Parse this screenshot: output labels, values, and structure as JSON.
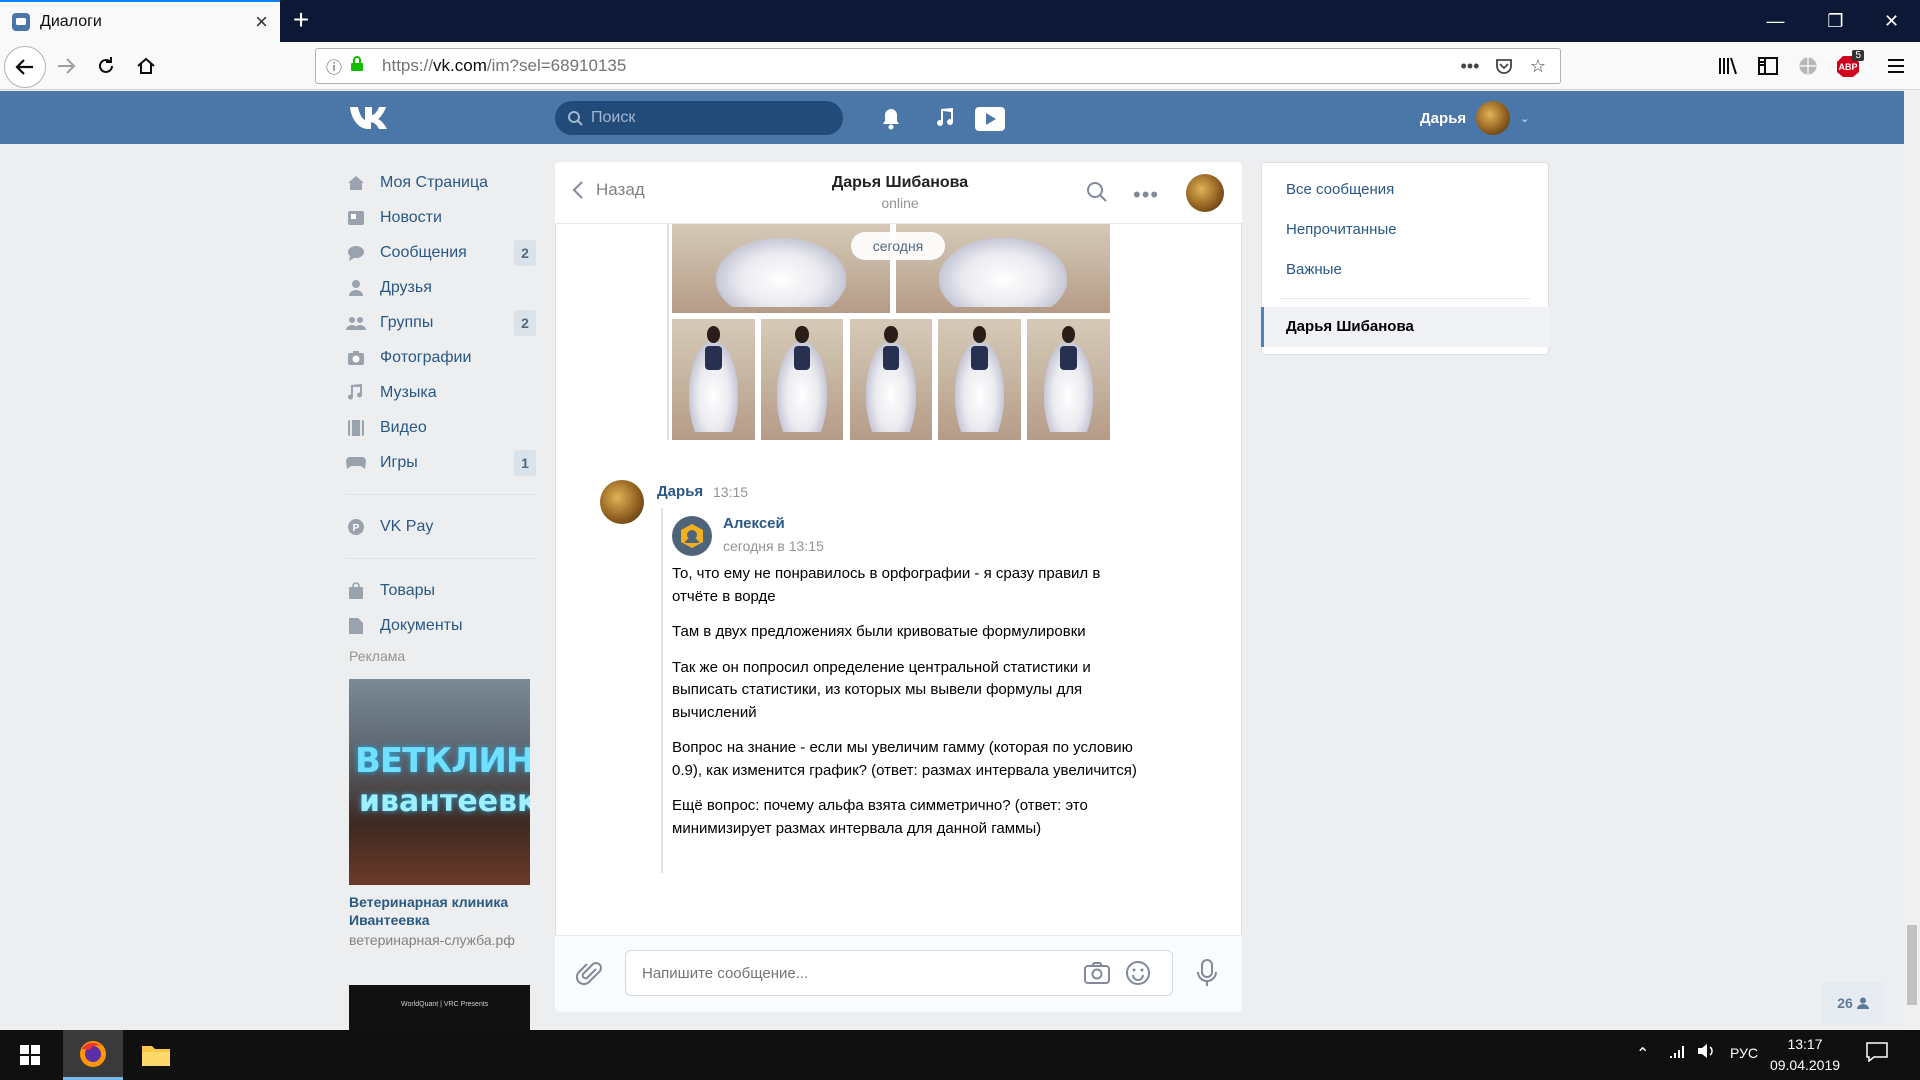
{
  "browser": {
    "tab_title": "Диалоги",
    "url_prefix": "https://",
    "url_host": "vk.com",
    "url_path": "/im?sel=68910135",
    "adblock_count": "5"
  },
  "vk_header": {
    "search_placeholder": "Поиск",
    "user_name": "Дарья"
  },
  "menu": {
    "items": [
      {
        "label": "Моя Страница",
        "icon": "home-icon",
        "badge": ""
      },
      {
        "label": "Новости",
        "icon": "news-icon",
        "badge": ""
      },
      {
        "label": "Сообщения",
        "icon": "messages-icon",
        "badge": "2"
      },
      {
        "label": "Друзья",
        "icon": "friends-icon",
        "badge": ""
      },
      {
        "label": "Группы",
        "icon": "groups-icon",
        "badge": "2"
      },
      {
        "label": "Фотографии",
        "icon": "camera-icon",
        "badge": ""
      },
      {
        "label": "Музыка",
        "icon": "music-icon",
        "badge": ""
      },
      {
        "label": "Видео",
        "icon": "video-icon",
        "badge": ""
      },
      {
        "label": "Игры",
        "icon": "gamepad-icon",
        "badge": "1"
      }
    ],
    "vkpay": "VK Pay",
    "goods": "Товары",
    "docs": "Документы"
  },
  "ads": {
    "label": "Реклама",
    "ad1_line1": "ВЕТКЛИНИКА",
    "ad1_line2": "ивантеевка",
    "ad1_title": "Ветеринарная клиника Ивантеевка",
    "ad1_domain": "ветеринарная-служба.рф",
    "ad2_text": "WorldQuant | VRC Presents"
  },
  "chat": {
    "back": "Назад",
    "name": "Дарья Шибанова",
    "status": "online",
    "date_divider": "сегодня",
    "message": {
      "author": "Дарья",
      "time": "13:15",
      "forwarded": {
        "author": "Алексей",
        "date": "сегодня в 13:15",
        "paragraphs": [
          "То, что ему не понравилось в орфографии - я сразу правил в отчёте в ворде",
          "Там в двух предложениях были кривоватые формулировки",
          "Так же он попросил определение центральной статистики и выписать статистики, из которых мы вывели формулы для вычислений",
          "Вопрос на знание - если мы увеличим гамму (которая по условию 0.9), как изменится график? (ответ: размах интервала увеличится)",
          "Ещё вопрос: почему альфа взята симметрично? (ответ: это минимизирует размах интервала для данной гаммы)"
        ]
      }
    },
    "input_placeholder": "Напишите сообщение..."
  },
  "right_panel": {
    "all": "Все сообщения",
    "unread": "Непрочитанные",
    "important": "Важные",
    "active": "Дарья Шибанова"
  },
  "online_count": "26",
  "taskbar": {
    "lang": "РУС",
    "time": "13:17",
    "date": "09.04.2019"
  },
  "colors": {
    "vk_blue": "#4a76a8",
    "link": "#2a5885",
    "bg": "#edeef0"
  }
}
